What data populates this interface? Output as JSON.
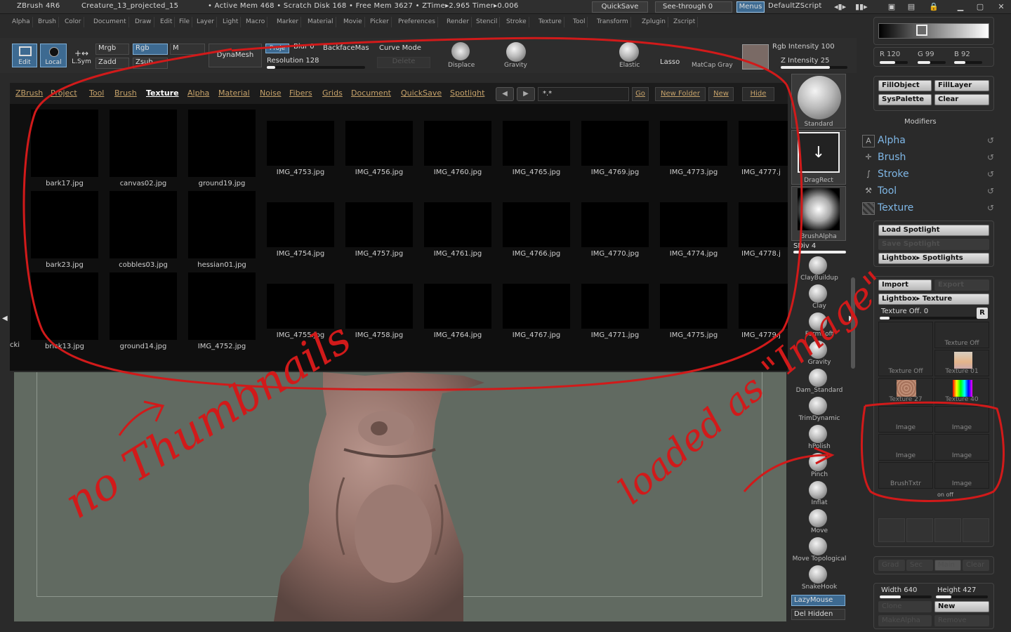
{
  "titlebar": {
    "app": "ZBrush 4R6",
    "doc": "Creature_13_projected_15",
    "stats": "• Active Mem 468 • Scratch Disk 168 • Free Mem 3627 • ZTime▸2.965 Timer▸0.006",
    "quicksave": "QuickSave",
    "seethrough": "See-through  0",
    "menus": "Menus",
    "script": "DefaultZScript"
  },
  "menubar": [
    "Alpha",
    "Brush",
    "Color",
    "Document",
    "Draw",
    "Edit",
    "File",
    "Layer",
    "Light",
    "Macro",
    "Marker",
    "Material",
    "Movie",
    "Picker",
    "Preferences",
    "Render",
    "Stencil",
    "Stroke",
    "Texture",
    "Tool",
    "Transform",
    "Zplugin",
    "Zscript"
  ],
  "shelf": {
    "edit": "Edit",
    "local": "Local",
    "lsym": "L.Sym",
    "mrgb": "Mrgb",
    "rgb": "Rgb",
    "m": "M",
    "zadd": "Zadd",
    "zsub": "Zsub",
    "dynamesh": "DynaMesh",
    "proj": "Proje",
    "blur": "Blur 0",
    "backface": "BackfaceMas",
    "curvemode": "Curve Mode",
    "resolution": "Resolution 128",
    "delete": "Delete",
    "displace": "Displace",
    "gravity": "Gravity",
    "elastic": "Elastic",
    "lasso": "Lasso",
    "matcap": "MatCap Gray",
    "rgb_intensity": "Rgb Intensity 100",
    "z_intensity": "Z Intensity 25"
  },
  "lightbox": {
    "tabs": [
      "ZBrush",
      "Project",
      "Tool",
      "Brush",
      "Texture",
      "Alpha",
      "Material",
      "Noise",
      "Fibers",
      "Grids",
      "Document",
      "QuickSave",
      "Spotlight"
    ],
    "active_tab": "Texture",
    "filter": "*.*",
    "go": "Go",
    "newfolder": "New Folder",
    "new": "New",
    "hide": "Hide",
    "files": [
      "bark17.jpg",
      "canvas02.jpg",
      "ground19.jpg",
      "IMG_4753.jpg",
      "IMG_4756.jpg",
      "IMG_4760.jpg",
      "IMG_4765.jpg",
      "IMG_4769.jpg",
      "IMG_4773.jpg",
      "IMG_4777.j",
      "bark23.jpg",
      "cobbles03.jpg",
      "hessian01.jpg",
      "IMG_4754.jpg",
      "IMG_4757.jpg",
      "IMG_4761.jpg",
      "IMG_4766.jpg",
      "IMG_4770.jpg",
      "IMG_4774.jpg",
      "IMG_4778.j",
      "brick13.jpg",
      "ground14.jpg",
      "IMG_4752.jpg",
      "IMG_4755.jpg",
      "IMG_4758.jpg",
      "IMG_4764.jpg",
      "IMG_4767.jpg",
      "IMG_4771.jpg",
      "IMG_4775.jpg",
      "IMG_4779.j"
    ],
    "edge_label": "cki"
  },
  "brushes": {
    "current": "Standard",
    "stroke": "DragRect",
    "alpha": "BrushAlpha",
    "sdiv": "SDiv 4",
    "list": [
      "ClayBuildup",
      "Clay",
      "FormSoft",
      "Gravity",
      "Dam_Standard",
      "TrimDynamic",
      "hPolish",
      "Pinch",
      "Inflat",
      "Move",
      "Move Topological",
      "SnakeHook"
    ],
    "lazymouse": "LazyMouse",
    "delhidden": "Del Hidden"
  },
  "color": {
    "r": "R 120",
    "g": "G 99",
    "b": "B 92"
  },
  "fill": {
    "fillobject": "FillObject",
    "filllayer": "FillLayer",
    "syspalette": "SysPalette",
    "clear": "Clear"
  },
  "modifiers_title": "Modifiers",
  "modifiers": [
    "Alpha",
    "Brush",
    "Stroke",
    "Tool",
    "Texture"
  ],
  "spotlight": {
    "load": "Load Spotlight",
    "save": "Save Spotlight",
    "lightbox": "Lightbox▸ Spotlights"
  },
  "texture": {
    "import": "Import",
    "export": "Export",
    "lightbox": "Lightbox▸ Texture",
    "current": "Texture Off. 0",
    "r": "R",
    "slots": [
      "Texture Off",
      "Texture Off",
      "Texture 01",
      "Texture 27",
      "Texture 40",
      "Image",
      "Image",
      "Image",
      "Image",
      "BrushTxtr",
      "Image"
    ],
    "onoff": "on off"
  },
  "misc": {
    "grad": "Grad",
    "sec": "Sec",
    "main": "Main",
    "clear": "Clear"
  },
  "size": {
    "width": "Width 640",
    "height": "Height 427",
    "new": "New",
    "clone": "Clone",
    "makealpha": "MakeAlpha",
    "remove": "Remove"
  },
  "annotations": {
    "left": "no Thumbnails",
    "right": "loaded as \"Image\""
  },
  "colors": {
    "accent": "#7fb7e6",
    "annotation": "#d11a1a",
    "canvas": "#616a61",
    "selected_swatch": "#7a6a65"
  }
}
